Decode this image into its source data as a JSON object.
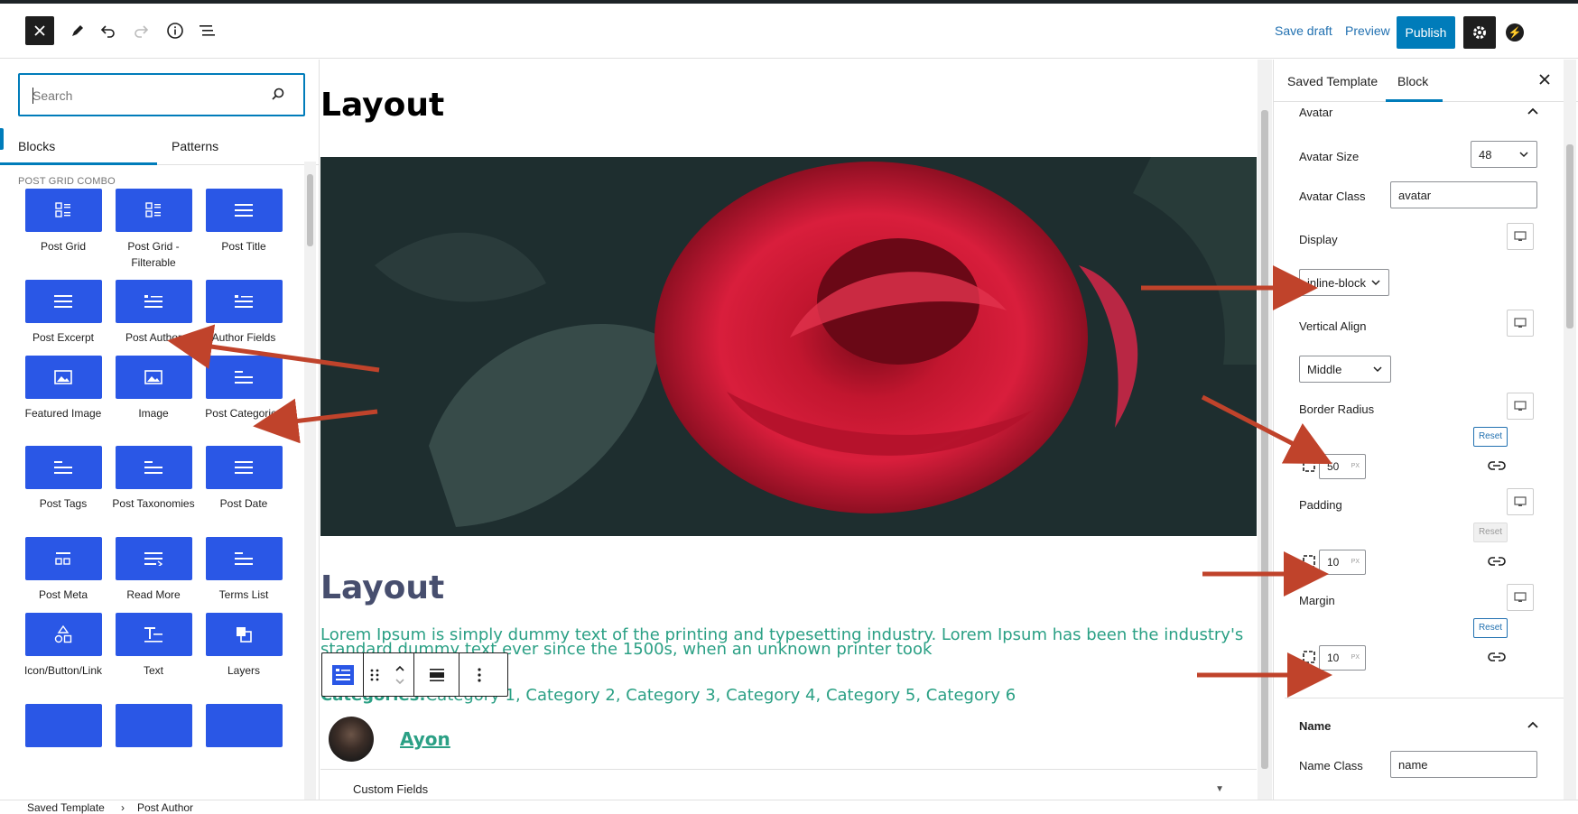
{
  "header": {
    "save_draft": "Save draft",
    "preview": "Preview",
    "publish": "Publish"
  },
  "inserter": {
    "search_placeholder": "Search",
    "tabs": [
      "Blocks",
      "Patterns"
    ],
    "category": "POST GRID COMBO",
    "blocks": [
      {
        "label": "Post Grid",
        "icon": "grid-icon"
      },
      {
        "label": "Post Grid - Filterable",
        "icon": "grid-icon"
      },
      {
        "label": "Post Title",
        "icon": "lines-icon"
      },
      {
        "label": "Post Excerpt",
        "icon": "lines-icon"
      },
      {
        "label": "Post Author",
        "icon": "author-icon"
      },
      {
        "label": "Author Fields",
        "icon": "author-icon"
      },
      {
        "label": "Featured Image",
        "icon": "image-icon"
      },
      {
        "label": "Image",
        "icon": "image-icon"
      },
      {
        "label": "Post Categories",
        "icon": "short-lines-icon"
      },
      {
        "label": "Post Tags",
        "icon": "short-lines-icon"
      },
      {
        "label": "Post Taxonomies",
        "icon": "short-lines-icon"
      },
      {
        "label": "Post Date",
        "icon": "lines-icon"
      },
      {
        "label": "Post Meta",
        "icon": "meta-icon"
      },
      {
        "label": "Read More",
        "icon": "readmore-icon"
      },
      {
        "label": "Terms List",
        "icon": "short-lines-icon"
      },
      {
        "label": "Icon/Button/Link",
        "icon": "shapes-icon"
      },
      {
        "label": "Text",
        "icon": "text-icon"
      },
      {
        "label": "Layers",
        "icon": "layers-icon"
      }
    ]
  },
  "canvas": {
    "title": "Layout",
    "post_title": "Layout",
    "excerpt": "Lorem Ipsum is simply dummy text of the printing and typesetting industry. Lorem Ipsum has been the industry's standard dummy text ever since the 1500s, when an unknown printer took",
    "categories_label": "Categories:",
    "categories": "Category 1, Category 2, Category 3, Category 4, Category 5, Category 6",
    "author_name": "Ayon",
    "custom_fields": "Custom Fields"
  },
  "sidebar": {
    "tabs": [
      "Saved Template",
      "Block"
    ],
    "avatar_panel": {
      "title": "Avatar",
      "avatar_size_label": "Avatar Size",
      "avatar_size_value": "48",
      "avatar_class_label": "Avatar Class",
      "avatar_class_value": "avatar",
      "display_label": "Display",
      "display_value": "inline-block",
      "vertical_align_label": "Vertical Align",
      "vertical_align_value": "Middle",
      "border_radius_label": "Border Radius",
      "border_radius_value": "50",
      "padding_label": "Padding",
      "padding_value": "10",
      "margin_label": "Margin",
      "margin_value": "10",
      "unit": "PX",
      "reset": "Reset"
    },
    "name_panel": {
      "title": "Name",
      "name_class_label": "Name Class",
      "name_class_value": "name"
    }
  },
  "breadcrumbs": [
    "Saved Template",
    "Post Author"
  ],
  "colors": {
    "accent": "#007cba",
    "block_tile": "#2a57e6",
    "text_green": "#2ba085",
    "arrow": "#c0432b"
  }
}
